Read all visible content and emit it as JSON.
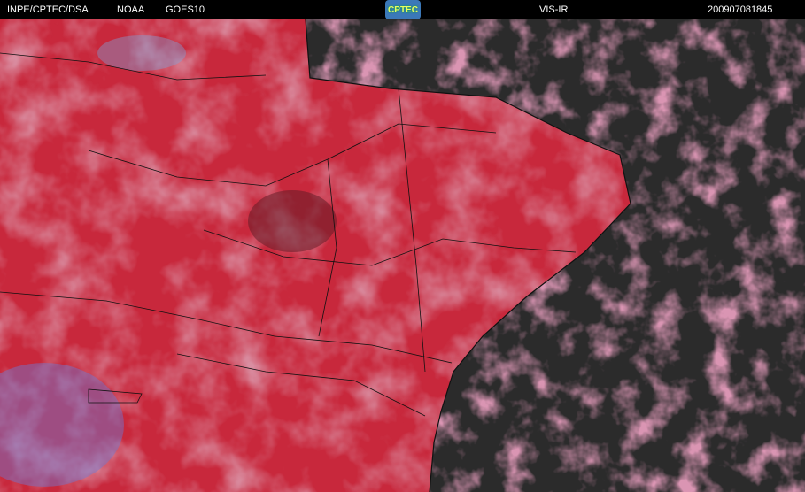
{
  "header": {
    "agency": "INPE/CPTEC/DSA",
    "source": "NOAA",
    "satellite": "GOES10",
    "logo_text": "CPTEC",
    "channel": "VIS-IR",
    "timestamp": "200907081845"
  },
  "colors": {
    "land": "#c8283c",
    "ocean": "#2b2b2b",
    "cloud": "#b0506e",
    "cold_cloud": "#6a7ad8"
  }
}
